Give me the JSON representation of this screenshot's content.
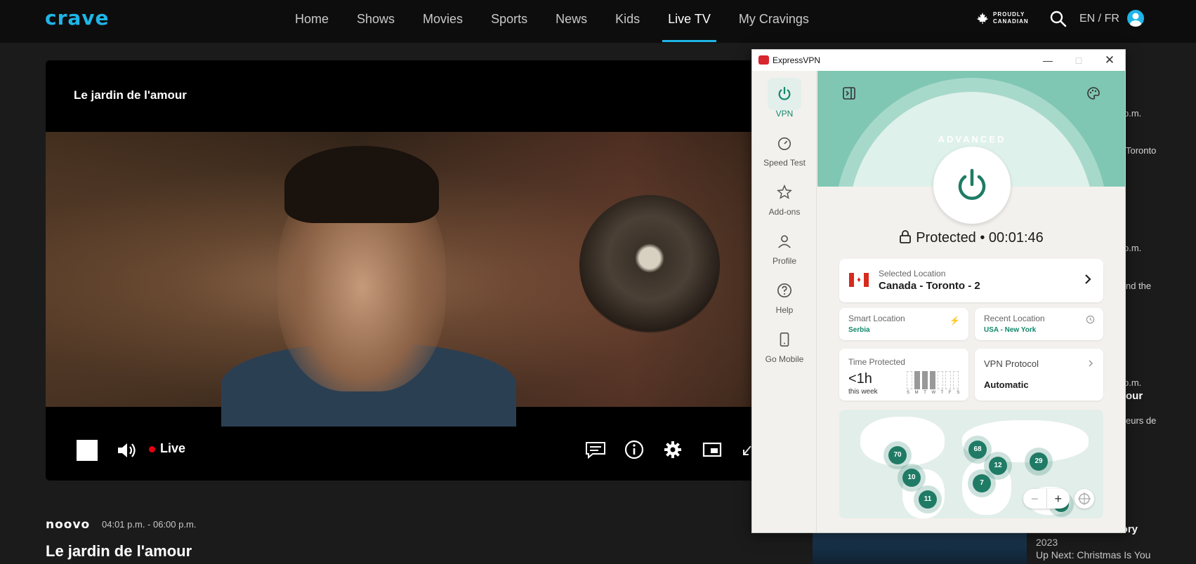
{
  "nav": {
    "logo": "crave",
    "links": [
      "Home",
      "Shows",
      "Movies",
      "Sports",
      "News",
      "Kids",
      "Live TV",
      "My Cravings"
    ],
    "proudly_line1": "PROUDLY",
    "proudly_line2": "CANADIAN",
    "lang": "EN / FR"
  },
  "player": {
    "title": "Le jardin de l'amour",
    "live_label": "Live"
  },
  "program": {
    "channel": "noovo",
    "time_range": "04:01 p.m. - 06:00 p.m.",
    "title": "Le jardin de l'amour"
  },
  "right_col": {
    "peek1": "p.m.",
    "peek2": "Toronto",
    "peek3": "p.m.",
    "peek4": "nd the",
    "peek5": "p.m.",
    "peek6": "our",
    "peek7": "eurs de",
    "card_title": "nder Story",
    "card_year": "2023",
    "card_next": "Up Next: Christmas Is You"
  },
  "vpn": {
    "window_title": "ExpressVPN",
    "sidebar": [
      "VPN",
      "Speed Test",
      "Add-ons",
      "Profile",
      "Help",
      "Go Mobile"
    ],
    "mode_label": "ADVANCED",
    "status": "Protected • 00:01:46",
    "selected_location_label": "Selected Location",
    "selected_location": "Canada - Toronto - 2",
    "smart_location_label": "Smart Location",
    "smart_location": "Serbia",
    "recent_location_label": "Recent Location",
    "recent_location": "USA - New York",
    "time_protected_label": "Time Protected",
    "time_protected_value": "<1h",
    "time_protected_sub": "this week",
    "week_days": "S M T W T F S",
    "protocol_label": "VPN Protocol",
    "protocol_value": "Automatic",
    "map_clusters": [
      "70",
      "10",
      "11",
      "68",
      "12",
      "7",
      "29",
      "8"
    ],
    "colors": {
      "accent": "#11886a",
      "hero": "#7fc7b3"
    }
  }
}
